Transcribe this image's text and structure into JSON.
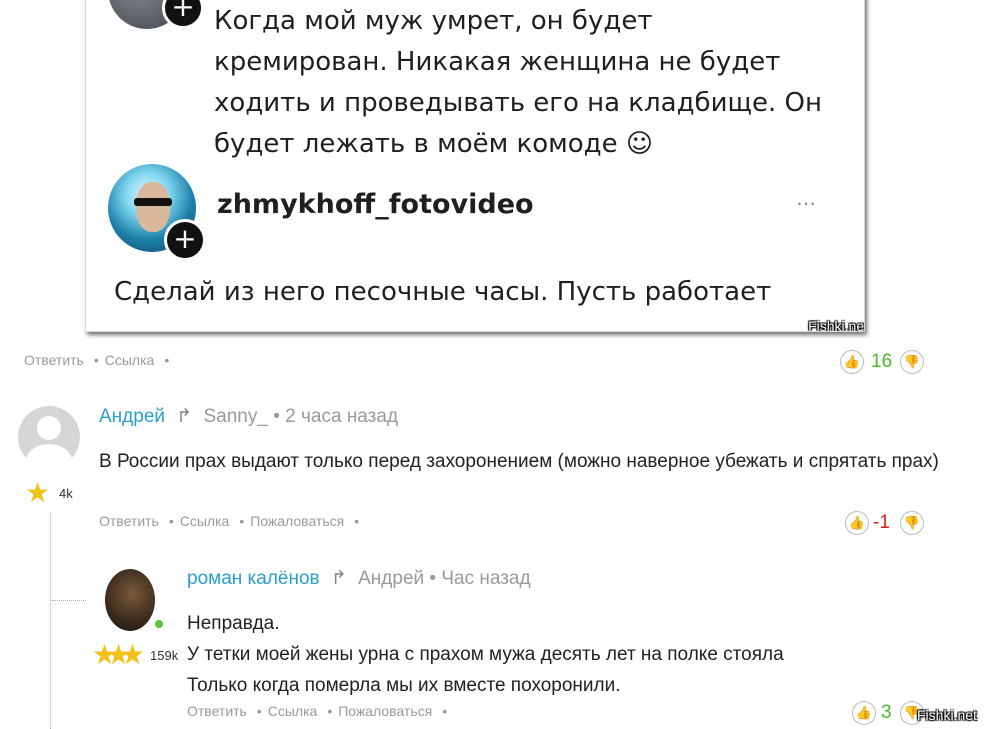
{
  "embedded_post": {
    "comment_text_lines": [
      "Когда мой муж умрет, он будет",
      "кремирован. Никакая женщина не будет",
      "ходить и проведывать его на кладбище. Он",
      "будет лежать в моём комоде ☺"
    ],
    "reply_username": "zhmykhoff_fotovideo",
    "more_icon": "⋯",
    "reply_text": "Сделай из него песочные часы. Пусть работает",
    "watermark": "Fishki.net"
  },
  "post_actions": {
    "reply": "Ответить",
    "link": "Ссылка",
    "sep": "•",
    "score": "16"
  },
  "comment1": {
    "author": "Андрей",
    "reply_to": "Sanny_",
    "time": "2 часа назад",
    "rank": "4k",
    "text": "В России прах выдают только перед захоронением (можно наверное убежать и спрятать прах)",
    "actions": {
      "reply": "Ответить",
      "link": "Ссылка",
      "report": "Пожаловаться"
    },
    "score": "-1"
  },
  "comment2": {
    "author": "роман калёнов",
    "reply_to": "Андрей",
    "time": "Час назад",
    "rank": "159k",
    "text_lines": [
      "Неправда.",
      "У тетки моей жены урна с прахом мужа десять лет на полке стояла",
      "Только когда померла мы их вместе похоронили."
    ],
    "actions": {
      "reply": "Ответить",
      "link": "Ссылка",
      "report": "Пожаловаться"
    },
    "score": "3"
  },
  "bottom_watermark": "Fishki.net",
  "colors": {
    "link": "#2a9fd0",
    "positive": "#4cb82a",
    "negative": "#e0201b",
    "meta": "#9a9a9a"
  }
}
